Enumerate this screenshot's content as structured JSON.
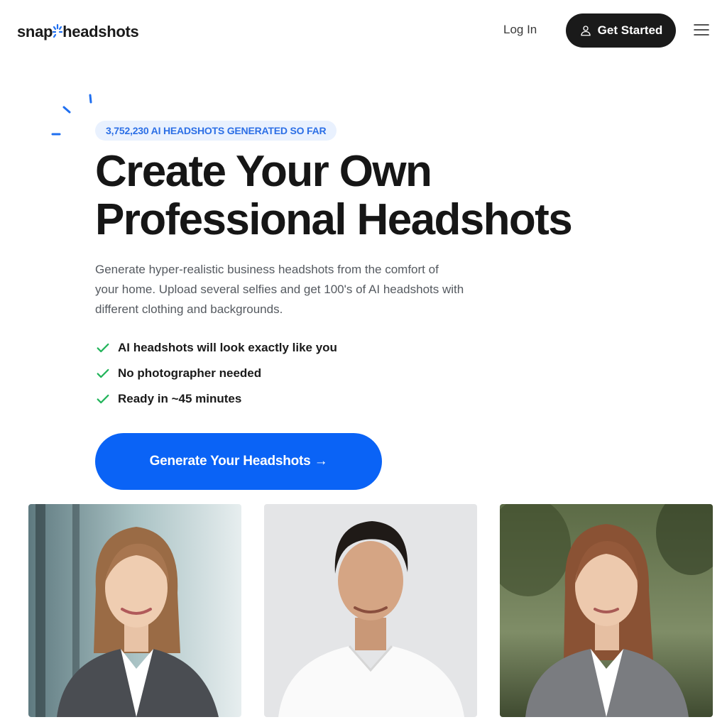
{
  "header": {
    "logo_left": "snap",
    "logo_right": "headshots",
    "login_label": "Log In",
    "get_started_label": "Get Started",
    "get_started_icon": "user-icon",
    "menu_icon": "hamburger-menu-icon"
  },
  "hero": {
    "badge": "3,752,230 AI HEADSHOTS GENERATED SO FAR",
    "title_line1": "Create Your Own",
    "title_line2": "Professional Headshots",
    "subtitle": "Generate hyper-realistic business headshots from the comfort of your home. Upload several selfies and get 100's of AI headshots with different clothing and backgrounds.",
    "features": [
      "AI headshots will look exactly like you",
      "No photographer needed",
      "Ready in ~45 minutes"
    ],
    "cta_label": "Generate Your Headshots →"
  },
  "colors": {
    "accent": "#0a63f6",
    "badge_bg": "#e9f1fe",
    "badge_text": "#2c6fe6",
    "check": "#22b45a",
    "dark": "#1a1a1a"
  }
}
